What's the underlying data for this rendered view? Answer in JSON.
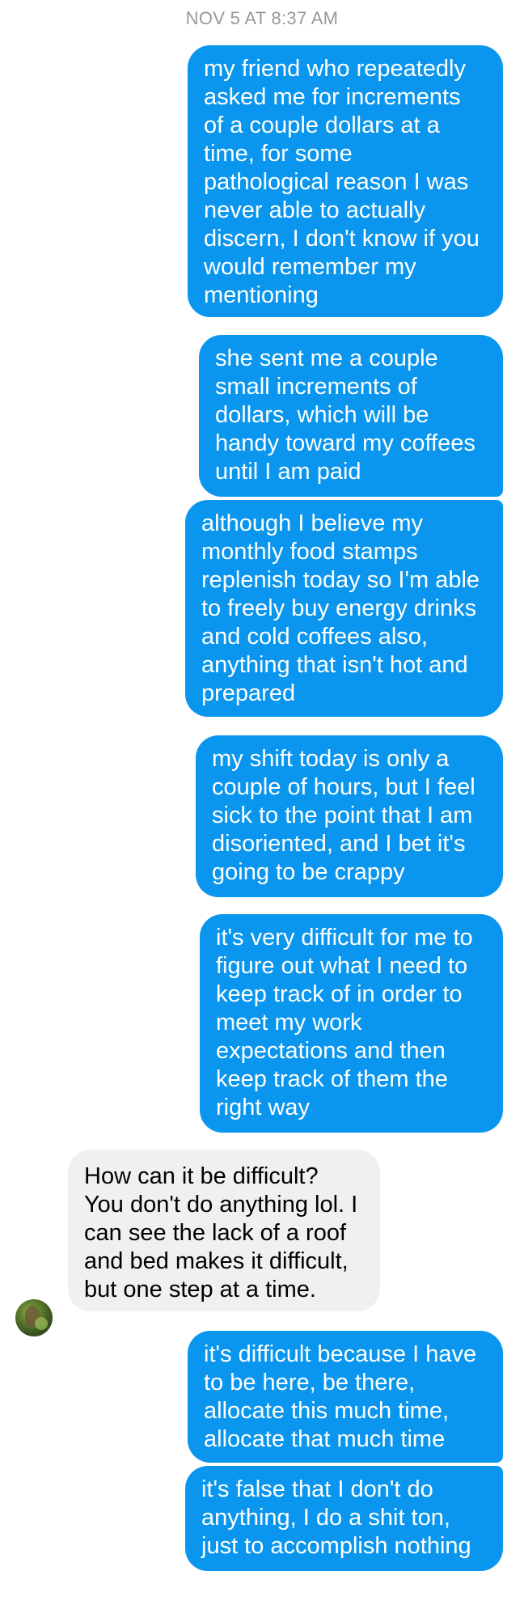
{
  "conversation": {
    "timestamp": "NOV 5 AT 8:37 AM",
    "messages": [
      {
        "from": "me",
        "text": "my friend who repeatedly\nasked me for increments\nof a couple dollars at a\ntime, for some\npathological reason I was\nnever able to actually\ndiscern, I don't know if you\nwould remember my\nmentioning"
      },
      {
        "from": "me",
        "text": "she sent me a couple\nsmall increments of\ndollars, which will be\nhandy toward my coffees\nuntil I am paid"
      },
      {
        "from": "me",
        "text": "although I believe my\nmonthly food stamps\nreplenish today so I'm able\nto freely buy energy drinks\nand cold coffees also,\nanything that isn't hot and\nprepared"
      },
      {
        "from": "me",
        "text": "my shift today is only a\ncouple of hours, but I feel\nsick to the point that I am\ndisoriented, and I bet it's\ngoing to be crappy"
      },
      {
        "from": "me",
        "text": "it's very difficult for me to\nfigure out what I need to\nkeep track of in order to\nmeet my work\nexpectations and then\nkeep track of them the\nright way"
      },
      {
        "from": "them",
        "text": "How can it be difficult?\nYou don't do anything lol. I\ncan see the lack of a roof\nand bed makes it difficult,\nbut one step at a time."
      },
      {
        "from": "me",
        "text": "it's difficult because I have\nto be here, be there,\nallocate this much time,\nallocate that much time"
      },
      {
        "from": "me",
        "text": "it's false that I don't do\nanything, I do a shit ton,\njust to accomplish nothing"
      }
    ]
  },
  "colors": {
    "outgoing_bubble": "#0a96ee",
    "incoming_bubble": "#f0f0f0",
    "timestamp_text": "#999999"
  },
  "icons": {
    "contact_avatar": "avatar-photo"
  }
}
